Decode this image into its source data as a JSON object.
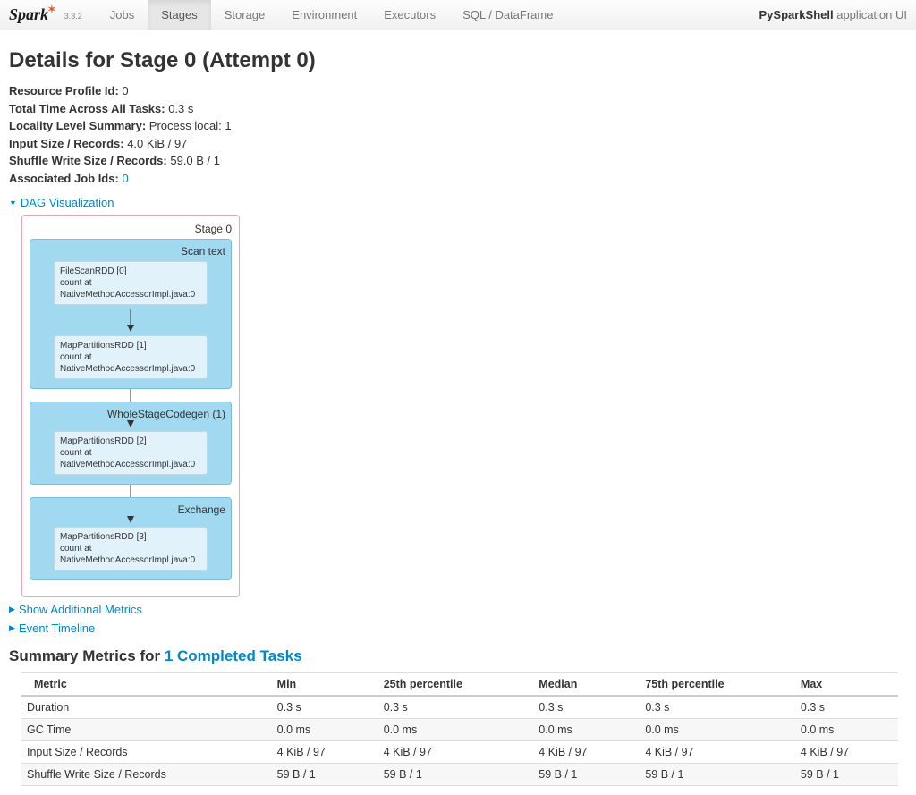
{
  "brand": {
    "name": "Spark",
    "version": "3.3.2"
  },
  "nav": {
    "tabs": [
      {
        "label": "Jobs",
        "active": false
      },
      {
        "label": "Stages",
        "active": true
      },
      {
        "label": "Storage",
        "active": false
      },
      {
        "label": "Environment",
        "active": false
      },
      {
        "label": "Executors",
        "active": false
      },
      {
        "label": "SQL / DataFrame",
        "active": false
      }
    ],
    "app_name": "PySparkShell",
    "app_suffix": " application UI"
  },
  "title": "Details for Stage 0 (Attempt 0)",
  "summary": {
    "resource_profile_label": "Resource Profile Id:",
    "resource_profile_value": " 0",
    "total_time_label": "Total Time Across All Tasks:",
    "total_time_value": " 0.3 s",
    "locality_label": "Locality Level Summary:",
    "locality_value": " Process local: 1",
    "input_label": "Input Size / Records:",
    "input_value": " 4.0 KiB / 97",
    "shuffle_label": "Shuffle Write Size / Records:",
    "shuffle_value": " 59.0 B / 1",
    "assoc_label": "Associated Job Ids:",
    "assoc_value": "0"
  },
  "collapsibles": {
    "dag": "DAG Visualization",
    "add_metrics": "Show Additional Metrics",
    "event_timeline": "Event Timeline"
  },
  "dag": {
    "stage_label": "Stage 0",
    "block1_title": "Scan text",
    "block1_node1_line1": "FileScanRDD [0]",
    "block1_node1_line2": "count at NativeMethodAccessorImpl.java:0",
    "block1_node2_line1": "MapPartitionsRDD [1]",
    "block1_node2_line2": "count at NativeMethodAccessorImpl.java:0",
    "block2_title": "WholeStageCodegen (1)",
    "block2_node1_line1": "MapPartitionsRDD [2]",
    "block2_node1_line2": "count at NativeMethodAccessorImpl.java:0",
    "block3_title": "Exchange",
    "block3_node1_line1": "MapPartitionsRDD [3]",
    "block3_node1_line2": "count at NativeMethodAccessorImpl.java:0"
  },
  "metrics_section": {
    "heading_prefix": "Summary Metrics for ",
    "heading_link": "1 Completed Tasks"
  },
  "metrics_table": {
    "headers": [
      "Metric",
      "Min",
      "25th percentile",
      "Median",
      "75th percentile",
      "Max"
    ],
    "rows": [
      [
        "Duration",
        "0.3 s",
        "0.3 s",
        "0.3 s",
        "0.3 s",
        "0.3 s"
      ],
      [
        "GC Time",
        "0.0 ms",
        "0.0 ms",
        "0.0 ms",
        "0.0 ms",
        "0.0 ms"
      ],
      [
        "Input Size / Records",
        "4 KiB / 97",
        "4 KiB / 97",
        "4 KiB / 97",
        "4 KiB / 97",
        "4 KiB / 97"
      ],
      [
        "Shuffle Write Size / Records",
        "59 B / 1",
        "59 B / 1",
        "59 B / 1",
        "59 B / 1",
        "59 B / 1"
      ]
    ]
  }
}
